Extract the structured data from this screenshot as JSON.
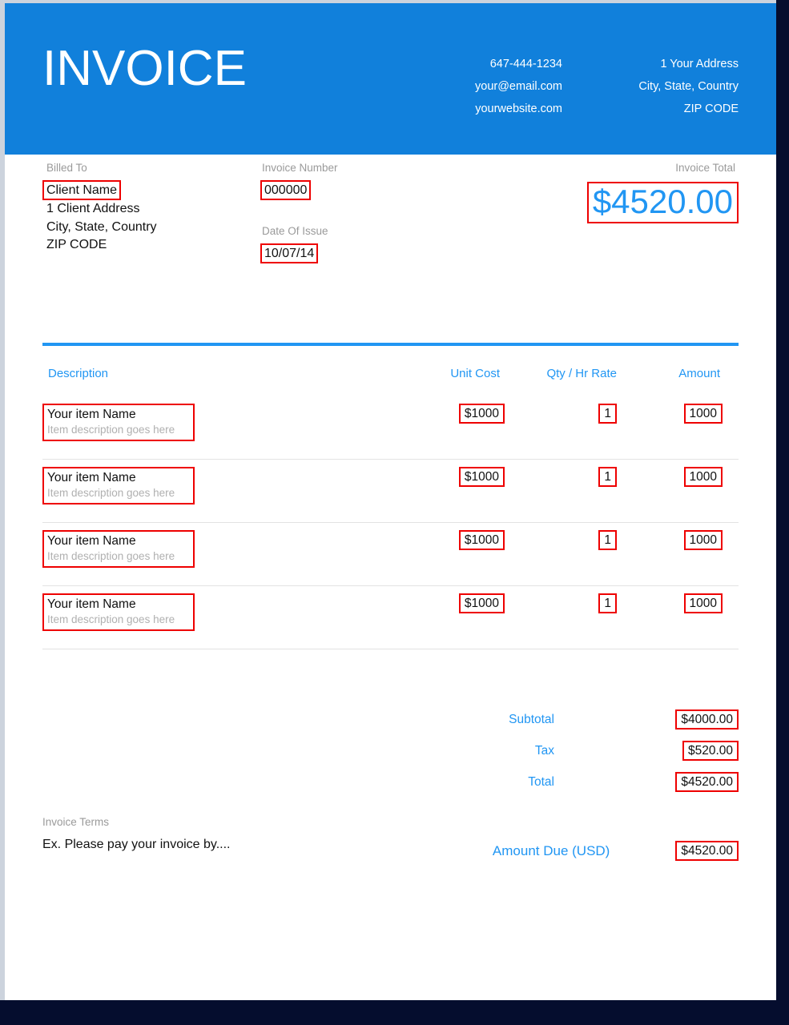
{
  "colors": {
    "brand_blue": "#1180db",
    "accent_blue": "#2196f3",
    "highlight_red": "#ee0000",
    "page_frame_gray": "#ccd3dd",
    "backdrop_navy": "#050d2e",
    "label_gray": "#9a9a9a",
    "muted_gray": "#b0b0b0"
  },
  "header": {
    "title": "INVOICE",
    "contact_left": [
      "647-444-1234",
      "your@email.com",
      "yourwebsite.com"
    ],
    "contact_right": [
      "1 Your Address",
      "City, State, Country",
      "ZIP CODE"
    ]
  },
  "billed_to": {
    "label": "Billed To",
    "client_name": "Client Name",
    "address_lines": [
      "1 Client Address",
      "City, State, Country",
      "ZIP CODE"
    ]
  },
  "invoice_meta": {
    "number_label": "Invoice Number",
    "number_value": "000000",
    "date_label": "Date Of Issue",
    "date_value": "10/07/14"
  },
  "invoice_total": {
    "label": "Invoice Total",
    "value": "$4520.00"
  },
  "items_table": {
    "columns": [
      "Description",
      "Unit Cost",
      "Qty / Hr Rate",
      "Amount"
    ],
    "rows": [
      {
        "name": "Your item Name",
        "description": "Item description goes here",
        "unit_cost": "$1000",
        "qty": "1",
        "amount": "1000"
      },
      {
        "name": "Your item Name",
        "description": "Item description goes here",
        "unit_cost": "$1000",
        "qty": "1",
        "amount": "1000"
      },
      {
        "name": "Your item Name",
        "description": "Item description goes here",
        "unit_cost": "$1000",
        "qty": "1",
        "amount": "1000"
      },
      {
        "name": "Your item Name",
        "description": "Item description goes here",
        "unit_cost": "$1000",
        "qty": "1",
        "amount": "1000"
      }
    ]
  },
  "totals": {
    "subtotal_label": "Subtotal",
    "subtotal_value": "$4000.00",
    "tax_label": "Tax",
    "tax_value": "$520.00",
    "total_label": "Total",
    "total_value": "$4520.00"
  },
  "footer": {
    "terms_label": "Invoice Terms",
    "terms_text": "Ex. Please pay your invoice by....",
    "amount_due_label": "Amount Due (USD)",
    "amount_due_value": "$4520.00"
  }
}
